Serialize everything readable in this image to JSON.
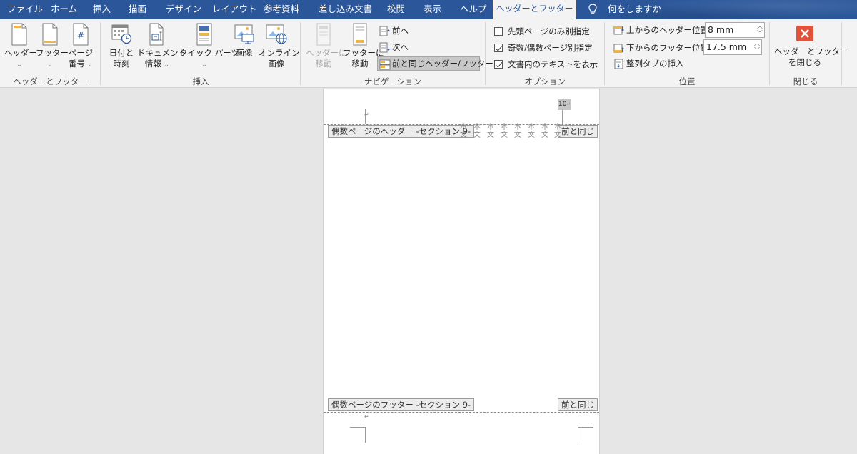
{
  "tabs": [
    {
      "label": "ファイル"
    },
    {
      "label": "ホーム"
    },
    {
      "label": "挿入"
    },
    {
      "label": "描画"
    },
    {
      "label": "デザイン"
    },
    {
      "label": "レイアウト"
    },
    {
      "label": "参考資料"
    },
    {
      "label": "差し込み文書"
    },
    {
      "label": "校閲"
    },
    {
      "label": "表示"
    },
    {
      "label": "ヘルプ"
    },
    {
      "label": "ヘッダーとフッター"
    }
  ],
  "tellme": {
    "label": "何をしますか",
    "icon": "lightbulb-icon"
  },
  "groups": {
    "header_footer": {
      "label": "ヘッダーとフッター",
      "header_btn": "ヘッダー",
      "footer_btn": "フッター",
      "page_num_line1": "ページ",
      "page_num_line2": "番号"
    },
    "insert": {
      "label": "挿入",
      "date_line1": "日付と",
      "date_line2": "時刻",
      "docinfo_line1": "ドキュメント",
      "docinfo_line2": "情報",
      "quickparts": "クイック パーツ",
      "image": "画像",
      "online_line1": "オンライン",
      "online_line2": "画像"
    },
    "navigation": {
      "label": "ナビゲーション",
      "goto_header_line1": "ヘッダーに",
      "goto_header_line2": "移動",
      "goto_footer_line1": "フッターに",
      "goto_footer_line2": "移動",
      "prev": "前へ",
      "next": "次へ",
      "link_prev": "前と同じヘッダー/フッター"
    },
    "options": {
      "label": "オプション",
      "first_page": {
        "label": "先頭ページのみ別指定",
        "checked": false
      },
      "odd_even": {
        "label": "奇数/偶数ページ別指定",
        "checked": true
      },
      "show_text": {
        "label": "文書内のテキストを表示",
        "checked": true
      }
    },
    "position": {
      "label": "位置",
      "header_pos_label": "上からのヘッダー位置:",
      "header_pos_value": "8 mm",
      "footer_pos_label": "下からのフッター位置:",
      "footer_pos_value": "17.5 mm",
      "align_tab": "整列タブの挿入"
    },
    "close": {
      "label": "閉じる",
      "btn_line1": "ヘッダーとフッター",
      "btn_line2": "を閉じる"
    }
  },
  "document": {
    "page_number": "10",
    "header_tag": "偶数ページのヘッダー -セクション 9-",
    "footer_tag": "偶数ページのフッター -セクション 9-",
    "same_as_prev": "前と同じ",
    "body_glyph": "本",
    "body_glyph2": "文",
    "return_mark": "↵"
  },
  "colors": {
    "tabbar": "#2b579a",
    "ribbon": "#f3f3f3",
    "close_red": "#e0533a",
    "doc_bg": "#e6e6e6"
  }
}
